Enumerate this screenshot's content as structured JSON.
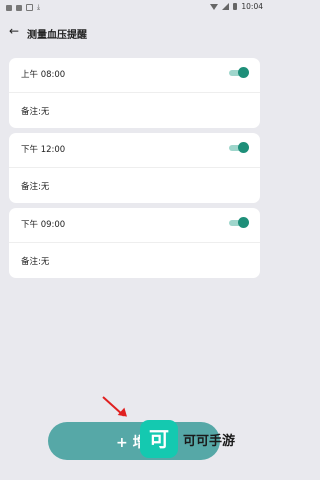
{
  "status_bar": {
    "time": "10:04"
  },
  "header": {
    "title": "测量血压提醒"
  },
  "reminders": [
    {
      "time": "上午 08:00",
      "note": "备注:无",
      "enabled": true
    },
    {
      "time": "下午 12:00",
      "note": "备注:无",
      "enabled": true
    },
    {
      "time": "下午 09:00",
      "note": "备注:无",
      "enabled": true
    }
  ],
  "add_button": {
    "label": "+ 增"
  },
  "watermark": {
    "logo_glyph": "可",
    "text": "可可手游"
  },
  "colors": {
    "accent": "#1e8f79",
    "button": "#56a8a7",
    "background": "#e9e9ee"
  }
}
